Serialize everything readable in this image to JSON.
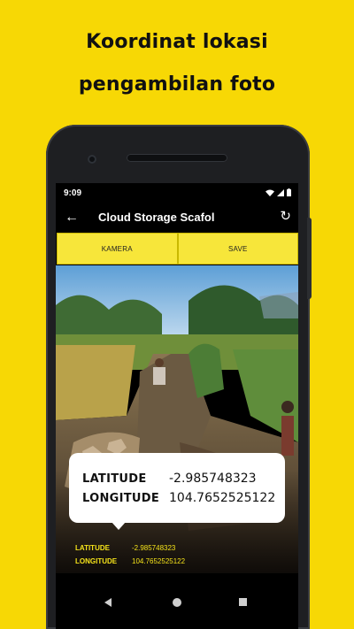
{
  "headline": {
    "line1": "Koordinat lokasi",
    "line2": "pengambilan foto"
  },
  "status_bar": {
    "time": "9:09",
    "icons": [
      "wifi-icon",
      "signal-icon",
      "battery-icon"
    ]
  },
  "app_bar": {
    "title": "Cloud Storage Scafol",
    "back_icon": "arrow-left-icon",
    "refresh_icon": "refresh-icon"
  },
  "buttons": {
    "camera_label": "KAMERA",
    "save_label": "SAVE"
  },
  "photo_overlay": {
    "latitude_label": "LATITUDE",
    "latitude_value": "-2.985748323",
    "longitude_label": "LONGITUDE",
    "longitude_value": "104.7652525122"
  },
  "callout": {
    "latitude_label": "LATITUDE",
    "latitude_value": "-2.985748323",
    "longitude_label": "LONGITUDE",
    "longitude_value": "104.7652525122"
  },
  "nav_bar": {
    "icons": [
      "nav-back-icon",
      "nav-home-icon",
      "nav-recent-icon"
    ]
  },
  "colors": {
    "background": "#f7d805",
    "button": "#f7e63a",
    "overlay_text": "#f5e31a"
  }
}
